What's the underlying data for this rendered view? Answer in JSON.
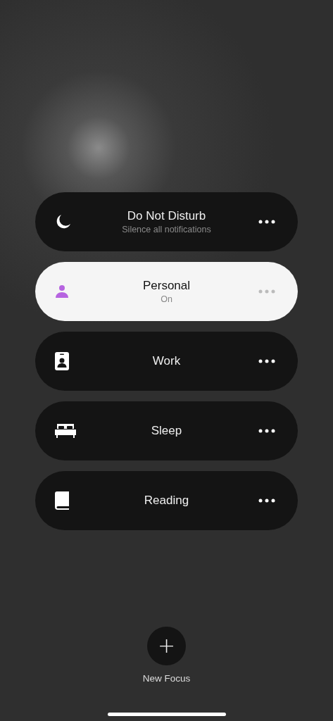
{
  "focus_modes": [
    {
      "kind": "moon",
      "title": "Do Not Disturb",
      "subtitle": "Silence all notifications",
      "selected": false
    },
    {
      "kind": "person",
      "title": "Personal",
      "subtitle": "On",
      "selected": true
    },
    {
      "kind": "badge",
      "title": "Work",
      "selected": false
    },
    {
      "kind": "bed",
      "title": "Sleep",
      "selected": false
    },
    {
      "kind": "book",
      "title": "Reading",
      "selected": false
    }
  ],
  "new_focus": {
    "symbol": "+",
    "label": "New Focus"
  }
}
